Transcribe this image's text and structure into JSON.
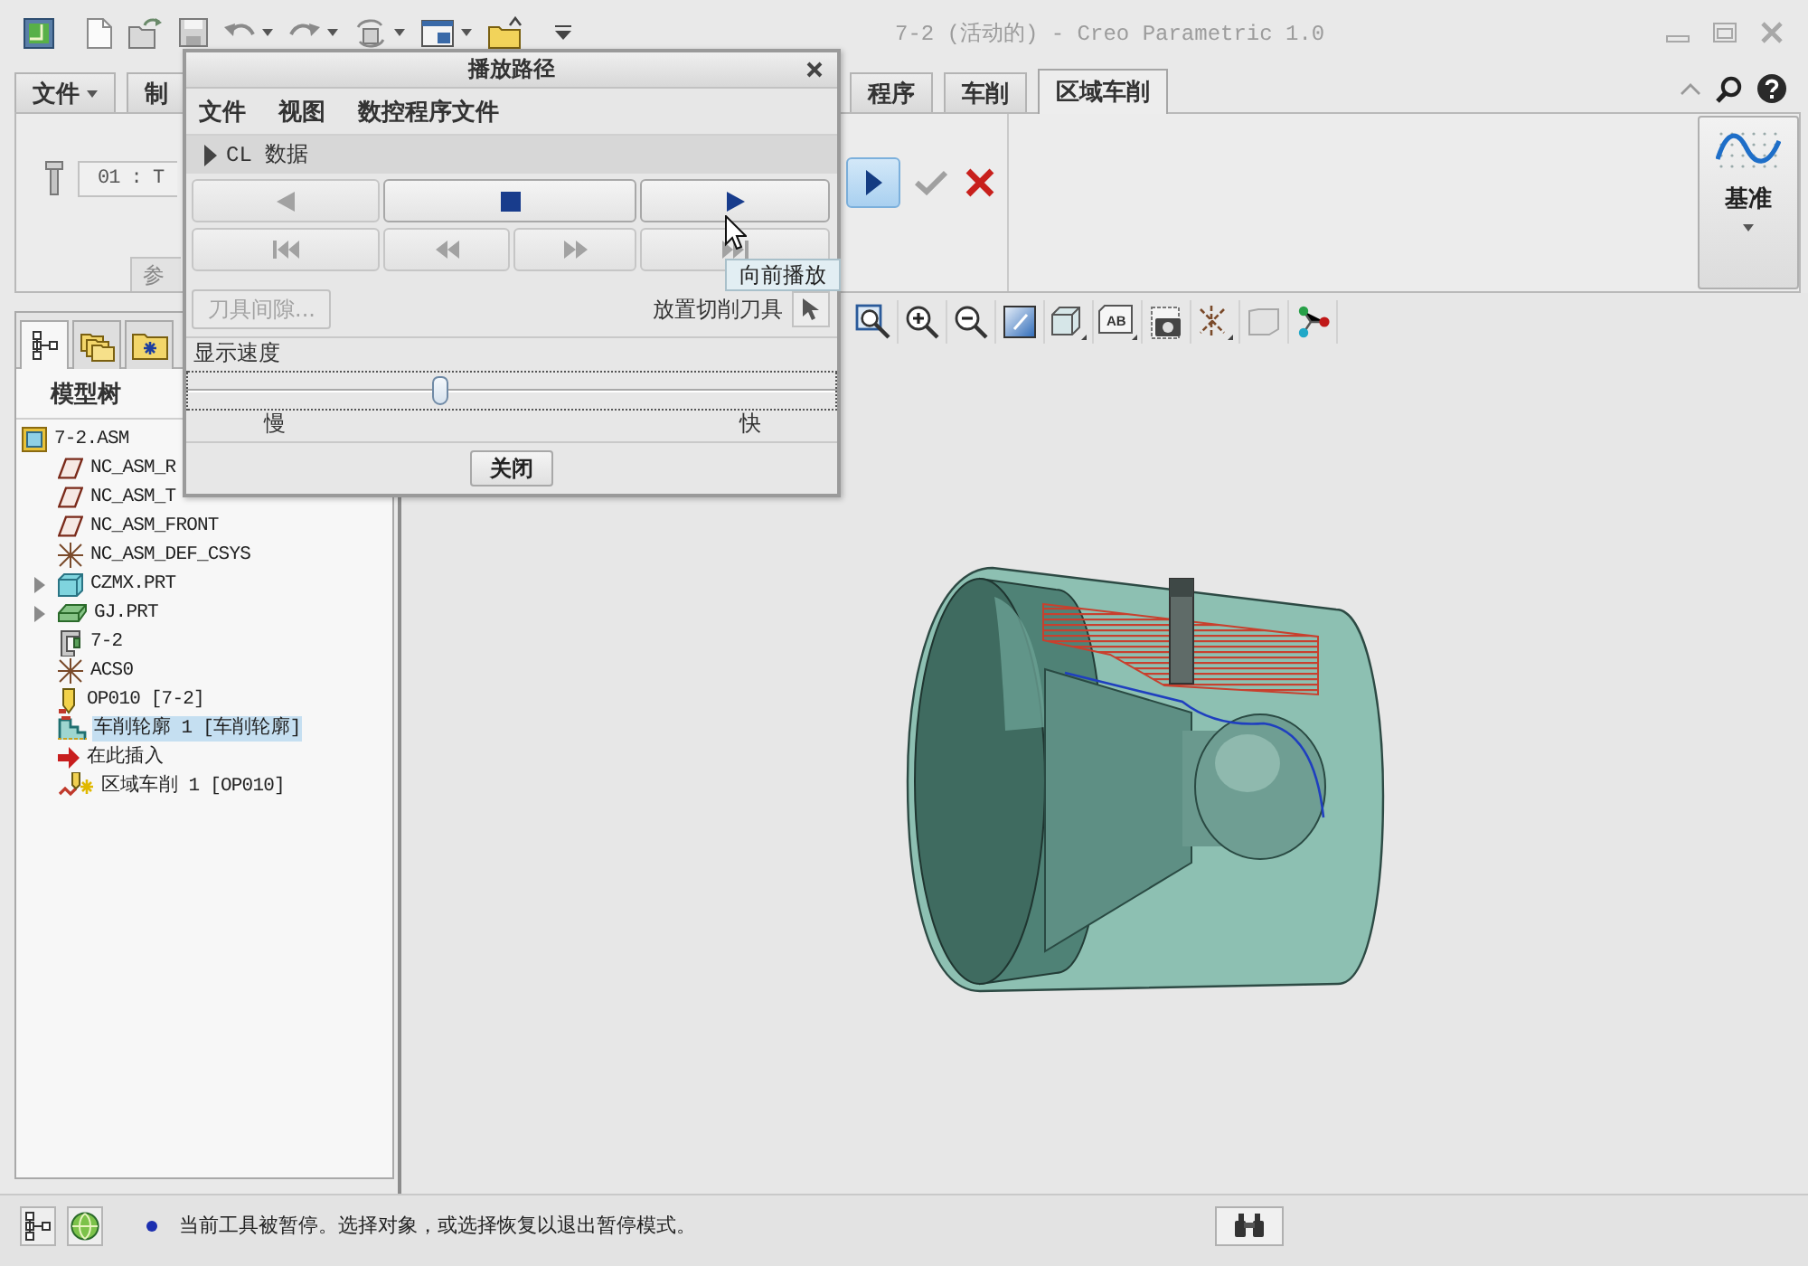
{
  "window": {
    "title": "7-2 (活动的) - Creo Parametric 1.0"
  },
  "ribbon": {
    "tabs": [
      {
        "label": "文件",
        "kind": "menu",
        "selected": false
      },
      {
        "label": "制",
        "kind": "tab",
        "selected": false
      },
      {
        "label": "程序",
        "kind": "tab",
        "selected": false
      },
      {
        "label": "车削",
        "kind": "tab",
        "selected": false
      },
      {
        "label": "区域车削",
        "kind": "tab",
        "selected": true
      }
    ],
    "tool_field": {
      "value": "01 : T"
    },
    "panel_button": {
      "label": "参"
    },
    "actions": [
      {
        "kind": "resume",
        "active": true,
        "disabled": false
      },
      {
        "kind": "confirm",
        "active": false,
        "disabled": true
      },
      {
        "kind": "cancel",
        "active": false,
        "disabled": false
      }
    ],
    "datum_group": {
      "label": "基准"
    }
  },
  "graphics_toolbar": {
    "view_badge": "AB"
  },
  "model_tree": {
    "panel_tabs": [
      {
        "kind": "tree",
        "selected": true
      },
      {
        "kind": "folders",
        "selected": false
      },
      {
        "kind": "favorites",
        "selected": false
      }
    ],
    "title": "模型树",
    "items": [
      {
        "label": "7-2.ASM",
        "kind": "assembly",
        "selected": false,
        "children": [
          {
            "label": "NC_ASM_R",
            "kind": "datum-plane",
            "collapsed": false,
            "selected": false
          },
          {
            "label": "NC_ASM_T",
            "kind": "datum-plane",
            "collapsed": false,
            "selected": false
          },
          {
            "label": "NC_ASM_FRONT",
            "kind": "datum-plane",
            "collapsed": false,
            "selected": false
          },
          {
            "label": "NC_ASM_DEF_CSYS",
            "kind": "csys",
            "collapsed": false,
            "selected": false
          },
          {
            "label": "CZMX.PRT",
            "kind": "part",
            "collapsed": true,
            "selected": false
          },
          {
            "label": "GJ.PRT",
            "kind": "workpiece",
            "collapsed": true,
            "selected": false
          },
          {
            "label": "7-2",
            "kind": "workcell",
            "collapsed": false,
            "selected": false
          },
          {
            "label": "ACS0",
            "kind": "csys",
            "collapsed": false,
            "selected": false
          },
          {
            "label": "OP010 [7-2]",
            "kind": "operation",
            "collapsed": false,
            "selected": false
          },
          {
            "label": "车削轮廓 1 [车削轮廓]",
            "kind": "turn-profile",
            "collapsed": false,
            "selected": true
          },
          {
            "label": "在此插入",
            "kind": "insert-marker",
            "collapsed": false,
            "selected": false
          },
          {
            "label": "区域车削 1 [OP010]",
            "kind": "area-turning",
            "collapsed": false,
            "selected": false
          }
        ]
      }
    ]
  },
  "playback_dialog": {
    "title": "播放路径",
    "menu": [
      "文件",
      "视图",
      "数控程序文件"
    ],
    "section": {
      "label": "CL 数据",
      "expanded": false
    },
    "control_rows": [
      {
        "buttons": [
          {
            "kind": "play-reverse",
            "disabled": true
          },
          {
            "kind": "stop",
            "disabled": false
          },
          {
            "kind": "play-forward",
            "disabled": false
          }
        ]
      },
      {
        "buttons": [
          {
            "kind": "to-start",
            "disabled": true
          },
          {
            "kind": "step-back",
            "disabled": true
          },
          {
            "kind": "step-forward",
            "disabled": true
          },
          {
            "kind": "to-end",
            "disabled": true
          }
        ]
      }
    ],
    "tool_clearance_button": {
      "label": "刀具间隙...",
      "disabled": true
    },
    "place_tool": {
      "label": "放置切削刀具"
    },
    "speed": {
      "label": "显示速度",
      "level": 0.39,
      "min_label": "慢",
      "max_label": "快"
    },
    "close_button": {
      "label": "关闭"
    },
    "tooltip": {
      "text": "向前播放"
    }
  },
  "status_bar": {
    "message": "当前工具被暂停。选择对象，或选择恢复以退出暂停模式。"
  }
}
